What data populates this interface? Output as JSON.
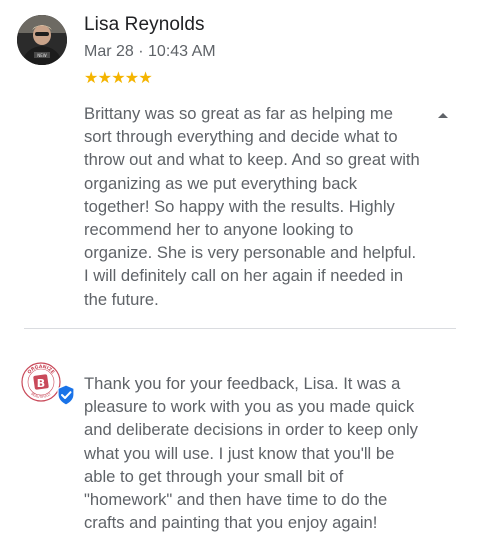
{
  "review": {
    "author_name": "Lisa Reynolds",
    "date": "Mar 28 · 10:43 AM",
    "rating": 5,
    "rating_max": 5,
    "star_color": "#f4b400",
    "text": "Brittany was so great as far as helping me sort through everything and decide what to throw out and what to keep. And so great with organizing as we put everything back together! So happy with the results. Highly recommend her to anyone looking to organize. She is very personable and helpful. I will definitely call on her again if needed in the future.",
    "avatar_icon": "user-photo-avatar",
    "collapse_icon": "caret-up-icon"
  },
  "reply": {
    "owner_logo_text_top": "ORGANIZE",
    "owner_logo_text_bottom": "BEAUTIFULLY",
    "owner_logo_letter": "B",
    "owner_logo_color": "#c94a5a",
    "verified_icon": "verified-badge-icon",
    "verified_color": "#1a73e8",
    "text": "Thank you for your feedback, Lisa. It was a pleasure to work with you as you made quick and deliberate decisions in order to keep only what you will use. I just know that you'll be able to get through your small bit of \"homework\" and then have time to do the crafts and painting that you enjoy again!"
  }
}
